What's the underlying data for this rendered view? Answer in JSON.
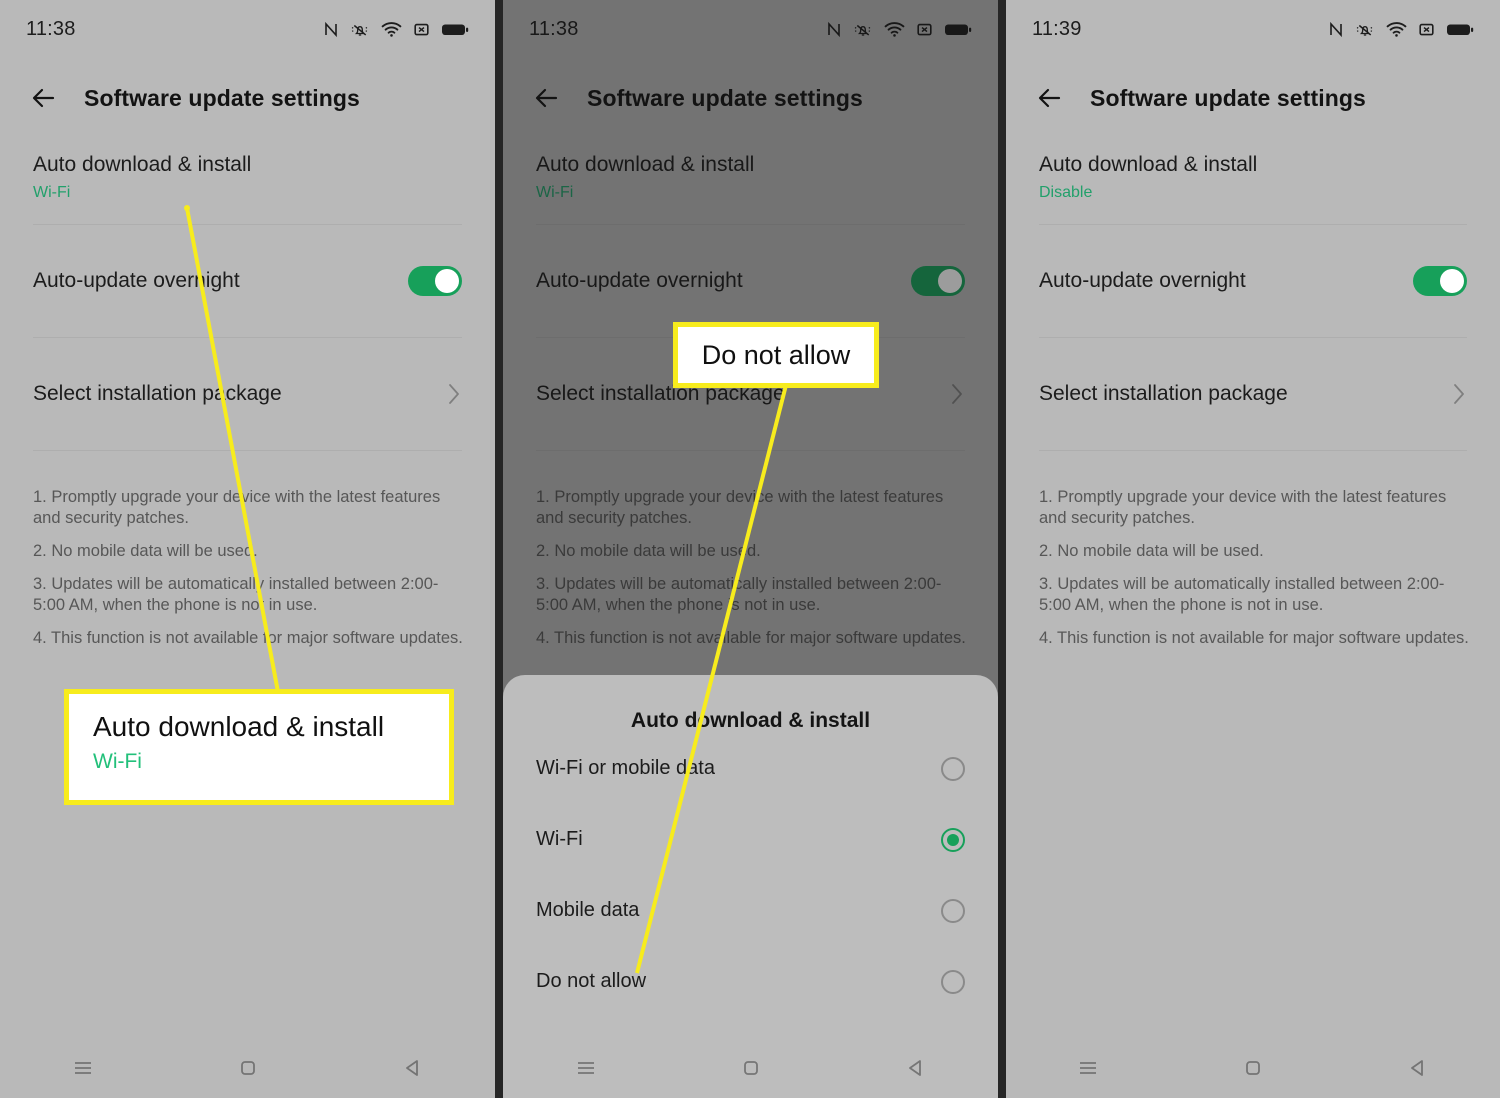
{
  "screens": [
    {
      "id": "screen-1",
      "status": {
        "time": "11:38",
        "icons": [
          "nfc-icon",
          "mute-bell-icon",
          "wifi-icon",
          "no-sim-icon",
          "battery-icon"
        ]
      },
      "appbar": {
        "title": "Software update settings",
        "back_icon": "back-arrow-icon"
      },
      "rows": {
        "auto_download": {
          "title": "Auto download & install",
          "value": "Wi-Fi"
        },
        "auto_update": {
          "title": "Auto-update overnight",
          "toggle_state": "on"
        },
        "select_package": {
          "title": "Select installation package",
          "chevron": "chevron-right-icon"
        }
      },
      "notes": [
        "1. Promptly upgrade your device with the latest features and security patches.",
        "2. No mobile data will be used.",
        "3. Updates will be automatically installed between 2:00-5:00 AM, when the phone is not in use.",
        "4. This function is not available for major software updates."
      ],
      "navbar": [
        "recents-icon",
        "home-icon",
        "back-icon"
      ]
    },
    {
      "id": "screen-2",
      "status": {
        "time": "11:38",
        "icons": [
          "nfc-icon",
          "mute-bell-icon",
          "wifi-icon",
          "no-sim-icon",
          "battery-icon"
        ]
      },
      "appbar": {
        "title": "Software update settings",
        "back_icon": "back-arrow-icon"
      },
      "rows": {
        "auto_download": {
          "title": "Auto download & install",
          "value": "Wi-Fi"
        },
        "auto_update": {
          "title": "Auto-update overnight",
          "toggle_state": "on"
        },
        "select_package": {
          "title": "Select installation package",
          "chevron": "chevron-right-icon"
        }
      },
      "notes": [
        "1. Promptly upgrade your device with the latest features and security patches.",
        "2. No mobile data will be used.",
        "3. Updates will be automatically installed between 2:00-5:00 AM, when the phone is not in use.",
        "4. This function is not available for major software updates."
      ],
      "sheet": {
        "title": "Auto download & install",
        "options": [
          {
            "label": "Wi-Fi or mobile data",
            "selected": false
          },
          {
            "label": "Wi-Fi",
            "selected": true
          },
          {
            "label": "Mobile data",
            "selected": false
          },
          {
            "label": "Do not allow",
            "selected": false
          }
        ]
      },
      "navbar": [
        "recents-icon",
        "home-icon",
        "back-icon"
      ]
    },
    {
      "id": "screen-3",
      "status": {
        "time": "11:39",
        "icons": [
          "nfc-icon",
          "mute-bell-icon",
          "wifi-icon",
          "no-sim-icon",
          "battery-icon"
        ]
      },
      "appbar": {
        "title": "Software update settings",
        "back_icon": "back-arrow-icon"
      },
      "rows": {
        "auto_download": {
          "title": "Auto download & install",
          "value": "Disable"
        },
        "auto_update": {
          "title": "Auto-update overnight",
          "toggle_state": "on"
        },
        "select_package": {
          "title": "Select installation package",
          "chevron": "chevron-right-icon"
        }
      },
      "notes": [
        "1. Promptly upgrade your device with the latest features and security patches.",
        "2. No mobile data will be used.",
        "3. Updates will be automatically installed between 2:00-5:00 AM, when the phone is not in use.",
        "4. This function is not available for major software updates."
      ],
      "navbar": [
        "recents-icon",
        "home-icon",
        "back-icon"
      ]
    }
  ],
  "annotations": {
    "callout_1": {
      "title": "Auto download & install",
      "subtitle": "Wi-Fi"
    },
    "callout_2": {
      "title": "Do not allow"
    }
  },
  "colors": {
    "accent_green": "#17a05a",
    "value_green": "#22a06b",
    "highlight_yellow": "#f7ec1d",
    "screen_bg": "#b9b9b9",
    "sheet_bg": "#bdbdbd",
    "divider": "#262626"
  }
}
